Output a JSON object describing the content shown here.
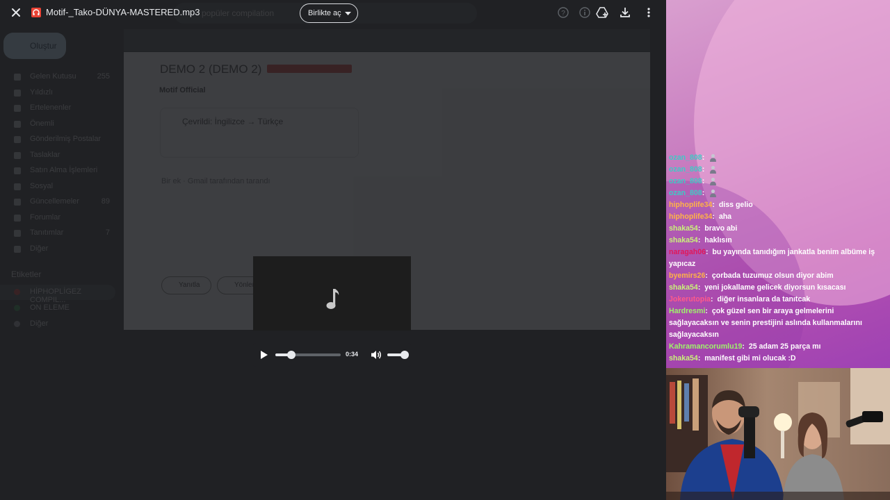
{
  "viewer": {
    "file_title": "Motif-_Tako-DÜNYA-MASTERED.mp3",
    "open_with_label": "Birlikte aç",
    "icons": [
      "close-icon",
      "audio-file-icon",
      "help-icon",
      "info-icon",
      "add-to-drive-icon",
      "download-icon",
      "more-vert-icon"
    ],
    "player": {
      "time": "0:34",
      "progress": 0.24,
      "volume": 0.9,
      "icons": [
        "music-note-icon",
        "play-icon",
        "volume-icon"
      ]
    }
  },
  "background_mail": {
    "search_placeholder": "popüler compilation",
    "compose_label": "Oluştur",
    "nav": [
      {
        "label": "Gelen Kutusu",
        "count": "255"
      },
      {
        "label": "Yıldızlı",
        "count": ""
      },
      {
        "label": "Ertelenenler",
        "count": ""
      },
      {
        "label": "Önemli",
        "count": ""
      },
      {
        "label": "Gönderilmiş Postalar",
        "count": ""
      },
      {
        "label": "Taslaklar",
        "count": ""
      },
      {
        "label": "Satın Alma İşlemleri",
        "count": ""
      },
      {
        "label": "Sosyal",
        "count": ""
      },
      {
        "label": "Güncellemeler",
        "count": "89"
      },
      {
        "label": "Forumlar",
        "count": ""
      },
      {
        "label": "Tanıtımlar",
        "count": "7"
      },
      {
        "label": "Diğer",
        "count": ""
      }
    ],
    "labels_title": "Etiketler",
    "labels": [
      {
        "label": "HİPHOPLİGEZ COMPIL...",
        "color": "#d93025"
      },
      {
        "label": "ON ELEME",
        "color": "#1e8e3e"
      },
      {
        "label": "Diğer",
        "color": "#9aa0a6"
      }
    ],
    "subject": "DEMO 2 (DEMO 2)",
    "sender": "Motif Official",
    "translated": "Çevrildi: İngilizce → Türkçe",
    "attachment_note": "Bir ek · Gmail tarafından tarandı",
    "reply_label": "Yanıtla",
    "forward_label": "Yönlendir"
  },
  "chat": {
    "messages": [
      {
        "user": "ozan_808",
        "color": "#3ecbc5",
        "text": "",
        "avatar": true
      },
      {
        "user": "ozan_808",
        "color": "#3ecbc5",
        "text": "",
        "avatar": true
      },
      {
        "user": "ozan_808",
        "color": "#3ecbc5",
        "text": "",
        "avatar": true
      },
      {
        "user": "ozan_808",
        "color": "#3ecbc5",
        "text": "",
        "avatar": true
      },
      {
        "user": "hiphoplife34",
        "color": "#ffb347",
        "text": "diss gelio",
        "avatar": false
      },
      {
        "user": "hiphoplife34",
        "color": "#ffb347",
        "text": "aha",
        "avatar": false
      },
      {
        "user": "shaka54",
        "color": "#c9f27a",
        "text": "bravo abi",
        "avatar": false
      },
      {
        "user": "shaka54",
        "color": "#c9f27a",
        "text": "haklısın",
        "avatar": false
      },
      {
        "user": "naragah06",
        "color": "#e0185a",
        "text": "bu yayında tanıdığım jankatla benim albüme iş yapıcaz",
        "avatar": false
      },
      {
        "user": "byemirs26",
        "color": "#ffb347",
        "text": "çorbada tuzumuz olsun diyor abim",
        "avatar": false
      },
      {
        "user": "shaka54",
        "color": "#c9f27a",
        "text": "yeni jokallame gelicek diyorsun kısacası",
        "avatar": false
      },
      {
        "user": "Jokerutopia",
        "color": "#ff5a8a",
        "text": "diğer insanlara da tanıtcak",
        "avatar": false
      },
      {
        "user": "Hardresmi",
        "color": "#9ef56a",
        "text": "çok güzel sen bir araya gelmelerini sağlayacaksın ve senin prestijini aslında kullanmalarını sağlayacaksın",
        "avatar": false
      },
      {
        "user": "Kahramancorumlu19",
        "color": "#9ef56a",
        "text": "25 adam 25 parça mı",
        "avatar": false
      },
      {
        "user": "shaka54",
        "color": "#c9f27a",
        "text": "manifest gibi mi olucak :D",
        "avatar": false
      }
    ]
  }
}
